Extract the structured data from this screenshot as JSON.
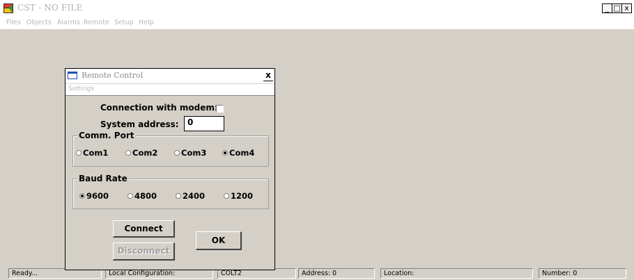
{
  "window": {
    "title": "CST - NO FILE",
    "buttons": {
      "minimize": "_",
      "maximize": "□",
      "close": "x"
    }
  },
  "menu": [
    "Files",
    "Objects",
    "Alarms",
    "Remote",
    "Setup",
    "Help"
  ],
  "dialog": {
    "title": "Remote Control",
    "close": "x",
    "menu": [
      "Settings"
    ],
    "modem_label": "Connection with modem:",
    "modem_checked": false,
    "address_label": "System address:",
    "address_value": "0",
    "comm_port": {
      "title": "Comm. Port",
      "options": [
        "Com1",
        "Com2",
        "Com3",
        "Com4"
      ],
      "selected": "Com4"
    },
    "baud_rate": {
      "title": "Baud Rate",
      "options": [
        "9600",
        "4800",
        "2400",
        "1200"
      ],
      "selected": "9600"
    },
    "connect_label": "Connect",
    "disconnect_label": "Disconnect",
    "ok_label": "OK"
  },
  "status": {
    "ready": "Ready...",
    "local_config": "Local Configuration:",
    "device": "COLT2",
    "address": "Address: 0",
    "location": "Location:",
    "number": "Number: 0"
  },
  "colors": {
    "accent": "#1c4fb3",
    "background": "#d4d0c8"
  }
}
